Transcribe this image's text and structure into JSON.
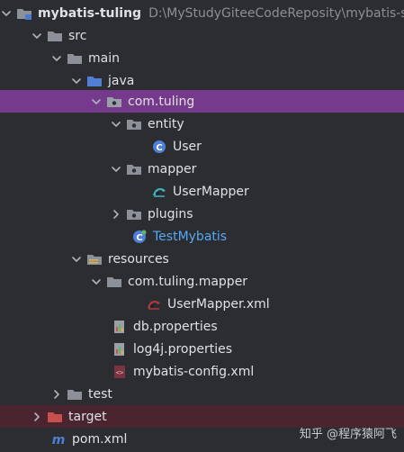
{
  "project": {
    "name": "mybatis-tuling",
    "path": "D:\\MyStudyGiteeCodeReposity\\mybatis-sc"
  },
  "tree": {
    "src": "src",
    "main": "main",
    "java": "java",
    "pkg_tuling": "com.tuling",
    "entity": "entity",
    "user": "User",
    "mapper": "mapper",
    "user_mapper": "UserMapper",
    "plugins": "plugins",
    "test_mybatis": "TestMybatis",
    "resources": "resources",
    "pkg_tuling_mapper": "com.tuling.mapper",
    "user_mapper_xml": "UserMapper.xml",
    "db_properties": "db.properties",
    "log4j_properties": "log4j.properties",
    "mybatis_config": "mybatis-config.xml",
    "test": "test",
    "target": "target",
    "pom": "pom.xml"
  },
  "watermark": "知乎 @程序猿阿飞",
  "colors": {
    "background": "#2b2d30",
    "selected_row": "#763a8c",
    "excluded_row": "#4a2530",
    "class_blue": "#56a8f5"
  },
  "icons": {
    "folder": "folder-icon",
    "source_folder": "source-folder-icon",
    "resources_folder": "resources-folder-icon",
    "package": "package-icon",
    "class": "class-icon",
    "mapper_interface": "mapper-interface-icon",
    "test_class": "test-class-icon",
    "xml_mapper": "mybatis-xml-icon",
    "properties": "properties-icon",
    "xml": "xml-icon",
    "excluded_folder": "excluded-folder-icon",
    "maven": "maven-icon"
  }
}
